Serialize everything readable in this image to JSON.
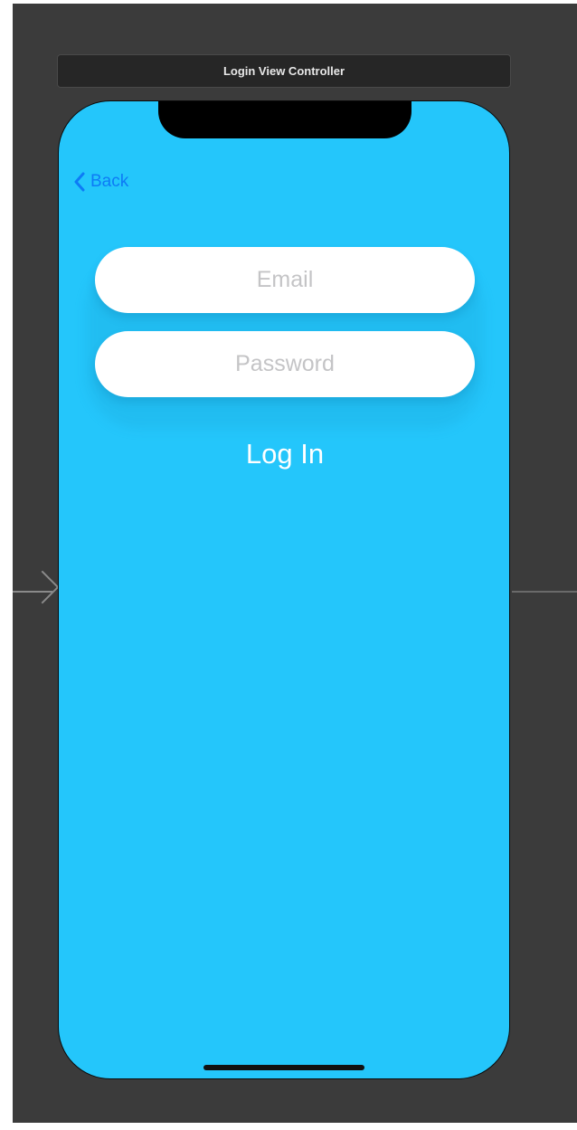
{
  "scene": {
    "title": "Login View Controller"
  },
  "navigation": {
    "back_label": "Back",
    "back_icon": "chevron-left-icon"
  },
  "form": {
    "email_placeholder": "Email",
    "email_value": "",
    "password_placeholder": "Password",
    "password_value": "",
    "login_label": "Log In"
  },
  "colors": {
    "canvas_background": "#3b3b3b",
    "screen_background": "#24c6fb",
    "back_tint": "#0d7bf6",
    "field_background": "#ffffff",
    "placeholder": "#c4c4c6",
    "login_text": "#ffffff"
  }
}
